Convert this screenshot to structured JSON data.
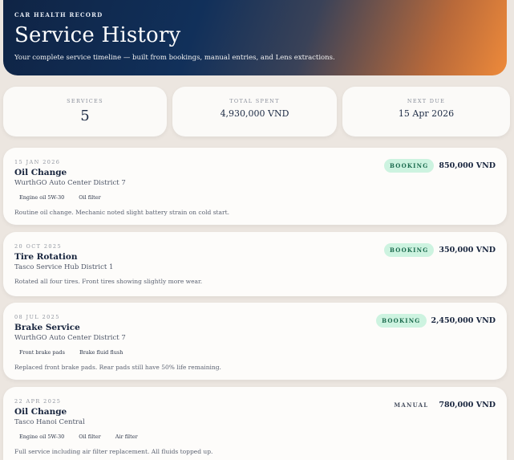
{
  "hero": {
    "eyebrow": "CAR HEALTH RECORD",
    "title": "Service History",
    "subtitle": "Your complete service timeline — built from bookings, manual entries, and Lens extractions."
  },
  "stats": [
    {
      "label": "SERVICES",
      "value": "5"
    },
    {
      "label": "TOTAL SPENT",
      "value": "4,930,000 VND"
    },
    {
      "label": "NEXT DUE",
      "value": "15 Apr 2026"
    }
  ],
  "records": [
    {
      "date": "15 JAN 2026",
      "title": "Oil Change",
      "location": "WurthGO Auto Center District 7",
      "parts": [
        "Engine oil 5W-30",
        "Oil filter"
      ],
      "note": "Routine oil change. Mechanic noted slight battery strain on cold start.",
      "source": "BOOKING",
      "amount": "850,000 VND"
    },
    {
      "date": "20 OCT 2025",
      "title": "Tire Rotation",
      "location": "Tasco Service Hub District 1",
      "parts": [],
      "note": "Rotated all four tires. Front tires showing slightly more wear.",
      "source": "BOOKING",
      "amount": "350,000 VND"
    },
    {
      "date": "08 JUL 2025",
      "title": "Brake Service",
      "location": "WurthGO Auto Center District 7",
      "parts": [
        "Front brake pads",
        "Brake fluid flush"
      ],
      "note": "Replaced front brake pads. Rear pads still have 50% life remaining.",
      "source": "BOOKING",
      "amount": "2,450,000 VND"
    },
    {
      "date": "22 APR 2025",
      "title": "Oil Change",
      "location": "Tasco Hanoi Central",
      "parts": [
        "Engine oil 5W-30",
        "Oil filter",
        "Air filter"
      ],
      "note": "Full service including air filter replacement. All fluids topped up.",
      "source": "MANUAL",
      "amount": "780,000 VND"
    }
  ]
}
